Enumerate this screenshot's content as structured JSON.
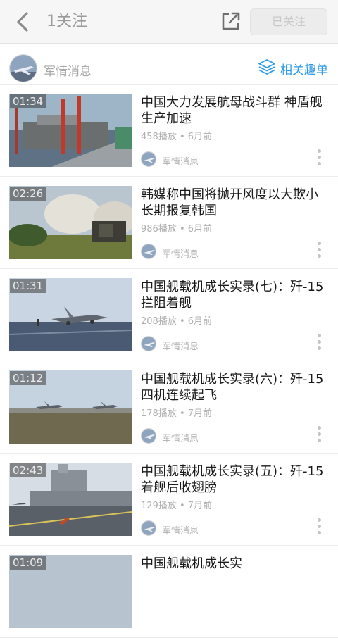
{
  "header": {
    "title": "1关注",
    "follow_label": "已关注",
    "icons": {
      "back": "back-arrow-icon",
      "share": "share-icon"
    }
  },
  "channel": {
    "name": "军情消息",
    "related_label": "相关趣单",
    "related_icon": "layers-icon",
    "accent_color": "#2d9be5"
  },
  "videos": [
    {
      "duration": "01:34",
      "title": "中国大力发展航母战斗群 神盾舰生产加速",
      "meta": "458播放 • 6月前",
      "source": "军情消息"
    },
    {
      "duration": "02:26",
      "title": "韩媒称中国将抛开风度以大欺小 长期报复韩国",
      "meta": "986播放 • 6月前",
      "source": "军情消息"
    },
    {
      "duration": "01:31",
      "title": "中国舰载机成长实录(七)：歼-15拦阻着舰",
      "meta": "208播放 • 6月前",
      "source": "军情消息"
    },
    {
      "duration": "01:12",
      "title": "中国舰载机成长实录(六)：歼-15四机连续起飞",
      "meta": "178播放 • 7月前",
      "source": "军情消息"
    },
    {
      "duration": "02:43",
      "title": "中国舰载机成长实录(五)：歼-15着舰后收翅膀",
      "meta": "129播放 • 7月前",
      "source": "军情消息"
    },
    {
      "duration": "01:09",
      "title": "中国舰载机成长实",
      "meta": "",
      "source": ""
    }
  ]
}
